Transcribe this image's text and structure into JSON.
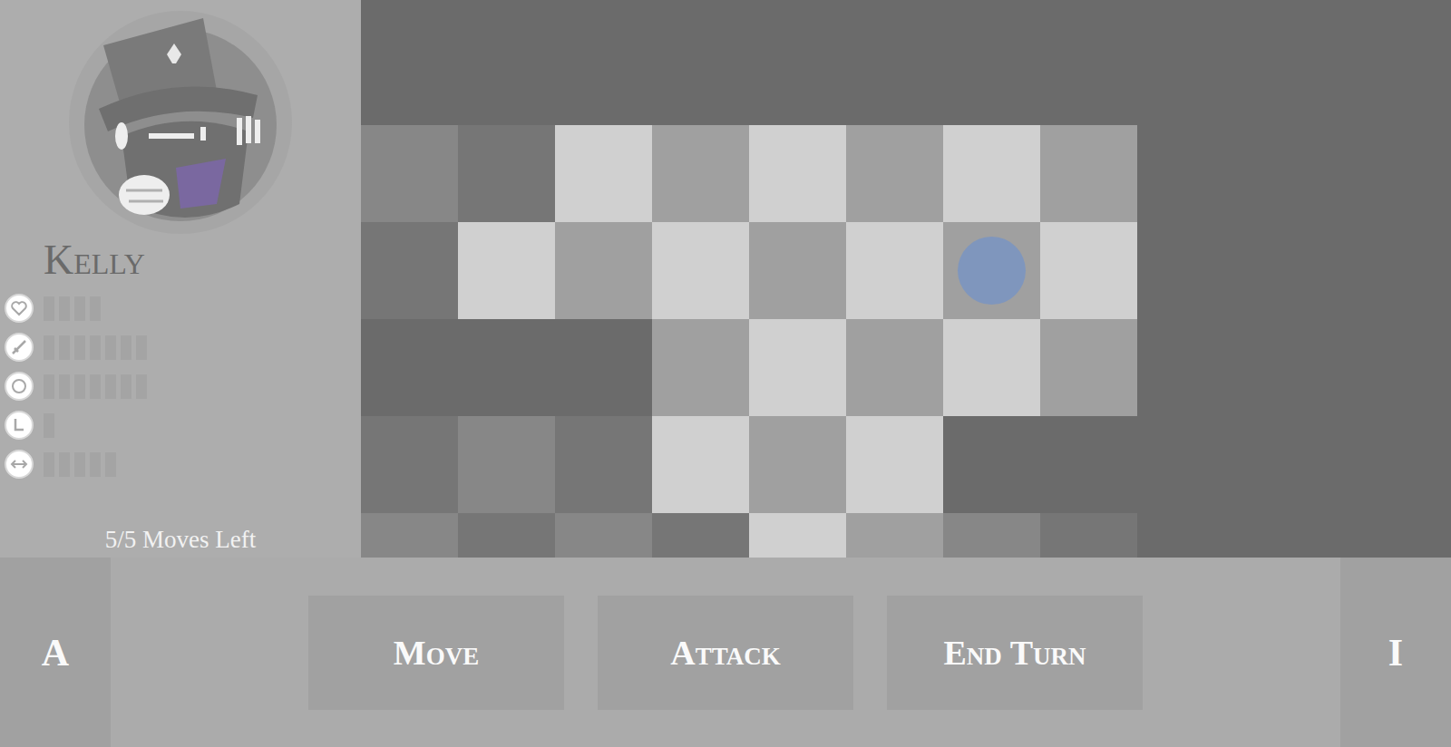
{
  "character": {
    "name": "Kelly",
    "stats": [
      {
        "pips": 4
      },
      {
        "pips": 7
      },
      {
        "pips": 7
      },
      {
        "pips": 1
      },
      {
        "pips": 5
      }
    ],
    "moves": "5/5 Moves Left"
  },
  "board": {
    "rows": [
      [
        {
          "kind": "fog"
        },
        {
          "kind": "fog"
        },
        {
          "kind": "reach"
        },
        {
          "kind": "reach"
        },
        {
          "kind": "reach"
        },
        {
          "kind": "reach"
        },
        {
          "kind": "reach"
        },
        {
          "kind": "reach"
        }
      ],
      [
        {
          "kind": "fog"
        },
        {
          "kind": "reach"
        },
        {
          "kind": "reach"
        },
        {
          "kind": "reach"
        },
        {
          "kind": "reach"
        },
        {
          "kind": "reach"
        },
        {
          "kind": "unit"
        },
        {
          "kind": "reach"
        }
      ],
      [
        {
          "kind": "void"
        },
        {
          "kind": "void"
        },
        {
          "kind": "void"
        },
        {
          "kind": "reach"
        },
        {
          "kind": "reach"
        },
        {
          "kind": "reach"
        },
        {
          "kind": "reach"
        },
        {
          "kind": "reach"
        }
      ],
      [
        {
          "kind": "fog"
        },
        {
          "kind": "fog"
        },
        {
          "kind": "fog"
        },
        {
          "kind": "reach"
        },
        {
          "kind": "reach"
        },
        {
          "kind": "reach"
        },
        {
          "kind": "void"
        },
        {
          "kind": "void"
        }
      ],
      [
        {
          "kind": "fog"
        },
        {
          "kind": "fog"
        },
        {
          "kind": "fog"
        },
        {
          "kind": "fog"
        },
        {
          "kind": "reach"
        },
        {
          "kind": "reach"
        },
        {
          "kind": "fog"
        },
        {
          "kind": "fog"
        }
      ]
    ]
  },
  "buttons": [
    {
      "label": "A",
      "kind": "side"
    },
    {
      "label": "Move",
      "kind": "action"
    },
    {
      "label": "Attack",
      "kind": "action"
    },
    {
      "label": "End Turn",
      "kind": "action"
    },
    {
      "label": "I",
      "kind": "side"
    }
  ]
}
